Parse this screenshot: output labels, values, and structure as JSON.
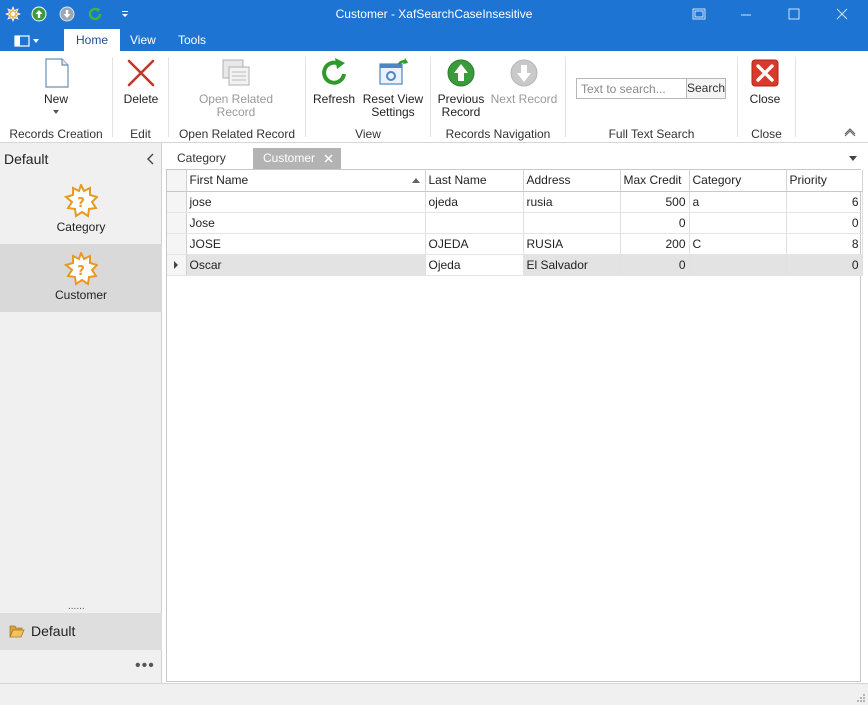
{
  "window": {
    "title": "Customer - XafSearchCaseInsesitive"
  },
  "ribbon_tabs": [
    {
      "label": "Home",
      "active": true
    },
    {
      "label": "View",
      "active": false
    },
    {
      "label": "Tools",
      "active": false
    }
  ],
  "ribbon": {
    "new_label": "New",
    "delete_label": "Delete",
    "open_related_line1": "Open Related",
    "open_related_line2": "Record",
    "refresh_label": "Refresh",
    "reset_view_line1": "Reset View",
    "reset_view_line2": "Settings",
    "previous_line1": "Previous",
    "previous_line2": "Record",
    "next_record_label": "Next Record",
    "search_placeholder": "Text to search...",
    "search_button_label": "Search",
    "close_label": "Close",
    "groups": {
      "records_creation": "Records Creation",
      "edit": "Edit",
      "open_related_record": "Open Related Record",
      "view": "View",
      "records_navigation": "Records Navigation",
      "full_text_search": "Full Text Search",
      "close": "Close"
    }
  },
  "sidebar": {
    "title": "Default",
    "items": [
      {
        "label": "Category",
        "selected": false
      },
      {
        "label": "Customer",
        "selected": true
      }
    ],
    "splitter_dots": "......",
    "group_label": "Default",
    "more_dots": "•••"
  },
  "doc_tabs": [
    {
      "label": "Category",
      "active": false
    },
    {
      "label": "Customer",
      "active": true
    }
  ],
  "grid": {
    "columns": [
      "First Name",
      "Last Name",
      "Address",
      "Max Credit",
      "Category",
      "Priority"
    ],
    "sorted_column": "First Name",
    "rows": [
      {
        "first_name": "jose",
        "last_name": "ojeda",
        "address": "rusia",
        "max_credit": "500",
        "category": "a",
        "priority": "6"
      },
      {
        "first_name": "Jose",
        "last_name": "",
        "address": "",
        "max_credit": "0",
        "category": "",
        "priority": "0"
      },
      {
        "first_name": "JOSE",
        "last_name": "OJEDA",
        "address": "RUSIA",
        "max_credit": "200",
        "category": "C",
        "priority": "8"
      },
      {
        "first_name": "Oscar",
        "last_name": "Ojeda",
        "address": "El Salvador",
        "max_credit": "0",
        "category": "",
        "priority": "0"
      }
    ],
    "focused_row": 3
  },
  "colors": {
    "titlebar": "#1e74d2",
    "sidebar_bg": "#f0f0f0",
    "selected_nav": "#d9d9d9",
    "active_doc_tab": "#b3b3b3",
    "focused_row": "#e3e3e3"
  }
}
